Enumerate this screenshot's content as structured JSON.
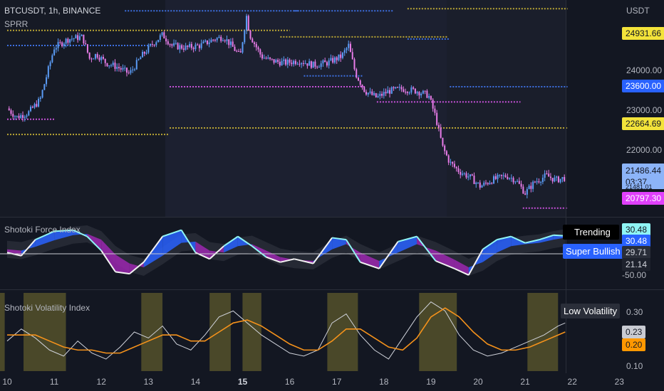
{
  "header": {
    "symbol": "BTCUSDT, 1h, BINANCE",
    "indicator": "SPRR",
    "currency": "USDT"
  },
  "colors": {
    "background": "#131722",
    "up": "#5b9cf6",
    "down": "#e87ce8",
    "resistance_blue": "#3d6fe0",
    "support_magenta": "#c651d8",
    "gold": "#b9a534",
    "force_pos": "#2962ff",
    "force_neg": "#9c27b0",
    "vol_fast": "#cfd2da",
    "vol_slow": "#f5921b",
    "low_vol_band": "#5e5a2c"
  },
  "price_panel": {
    "axis_ticks": [
      "24000.00",
      "23000.00",
      "22000.00"
    ],
    "tags": {
      "r1": "24931.66",
      "r2": "23600.00",
      "r3": "22664.69",
      "last": "21486.44",
      "countdown": "03:37",
      "low": "20797.30",
      "hidden_small": "21481.01"
    }
  },
  "force_panel": {
    "title": "Shotoki Force Index",
    "trend_label": "Trending",
    "state_label": "Super Bullish",
    "tags": [
      "30.48",
      "30.48",
      "29.71",
      "21.14",
      "-50.00"
    ]
  },
  "volatility_panel": {
    "title": "Shotoki Volatility Index",
    "state_label": "Low Volatility",
    "axis_ticks": [
      "0.30",
      "0.10"
    ],
    "tags": [
      "0.23",
      "0.20"
    ]
  },
  "x_axis": {
    "labels": [
      "10",
      "11",
      "12",
      "13",
      "14",
      "15",
      "16",
      "17",
      "18",
      "19",
      "20",
      "21",
      "22",
      "23"
    ]
  },
  "chart_data": [
    {
      "type": "candlestick",
      "title": "BTCUSDT, 1h, BINANCE",
      "x_labels": [
        "10",
        "11",
        "12",
        "13",
        "14",
        "15",
        "16",
        "17",
        "18",
        "19",
        "20",
        "21",
        "22",
        "23"
      ],
      "ylim": [
        20600,
        25600
      ],
      "price_path": [
        [
          0,
          23100
        ],
        [
          0.2,
          22900
        ],
        [
          0.45,
          23000
        ],
        [
          0.7,
          23300
        ],
        [
          0.85,
          23900
        ],
        [
          1.0,
          24500
        ],
        [
          1.3,
          24700
        ],
        [
          1.6,
          24750
        ],
        [
          1.75,
          24250
        ],
        [
          1.9,
          24350
        ],
        [
          2.1,
          24150
        ],
        [
          2.35,
          24050
        ],
        [
          2.6,
          23900
        ],
        [
          2.85,
          24300
        ],
        [
          3.1,
          24600
        ],
        [
          3.3,
          24800
        ],
        [
          3.5,
          24550
        ],
        [
          3.8,
          24500
        ],
        [
          4.1,
          24550
        ],
        [
          4.4,
          24700
        ],
        [
          4.6,
          24750
        ],
        [
          4.8,
          24500
        ],
        [
          4.95,
          24300
        ],
        [
          5.08,
          25250
        ],
        [
          5.15,
          24800
        ],
        [
          5.4,
          24300
        ],
        [
          5.6,
          24200
        ],
        [
          5.9,
          24150
        ],
        [
          6.2,
          24200
        ],
        [
          6.5,
          24100
        ],
        [
          6.8,
          24150
        ],
        [
          7.1,
          24300
        ],
        [
          7.25,
          24550
        ],
        [
          7.4,
          23900
        ],
        [
          7.6,
          23500
        ],
        [
          7.85,
          23350
        ],
        [
          8.1,
          23500
        ],
        [
          8.4,
          23550
        ],
        [
          8.7,
          23500
        ],
        [
          8.95,
          23400
        ],
        [
          9.1,
          22900
        ],
        [
          9.25,
          22200
        ],
        [
          9.4,
          21850
        ],
        [
          9.6,
          21650
        ],
        [
          9.85,
          21500
        ],
        [
          10.05,
          21300
        ],
        [
          10.3,
          21450
        ],
        [
          10.6,
          21550
        ],
        [
          10.8,
          21450
        ],
        [
          11.0,
          21150
        ],
        [
          11.2,
          21400
        ],
        [
          11.45,
          21550
        ],
        [
          11.65,
          21450
        ],
        [
          11.85,
          21500
        ]
      ],
      "levels": [
        {
          "price": 25350,
          "x0": 2.5,
          "x1": 6.2,
          "color": "blue"
        },
        {
          "price": 24900,
          "x0": 0.0,
          "x1": 6.0,
          "color": "gold"
        },
        {
          "price": 24750,
          "x0": 5.8,
          "x1": 9.35,
          "color": "gold"
        },
        {
          "price": 25350,
          "x0": 6.1,
          "x1": 8.2,
          "color": "blue"
        },
        {
          "price": 25400,
          "x0": 8.5,
          "x1": 11.9,
          "color": "gold"
        },
        {
          "price": 24700,
          "x0": 8.5,
          "x1": 9.4,
          "color": "blue"
        },
        {
          "price": 24550,
          "x0": 0.0,
          "x1": 3.0,
          "color": "blue"
        },
        {
          "price": 23600,
          "x0": 3.45,
          "x1": 7.6,
          "color": "magenta"
        },
        {
          "price": 23850,
          "x0": 6.3,
          "x1": 7.55,
          "color": "blue"
        },
        {
          "price": 23600,
          "x0": 9.4,
          "x1": 11.9,
          "color": "blue"
        },
        {
          "price": 23250,
          "x0": 7.85,
          "x1": 10.9,
          "color": "magenta"
        },
        {
          "price": 22650,
          "x0": 3.45,
          "x1": 11.9,
          "color": "gold"
        },
        {
          "price": 22850,
          "x0": 0.0,
          "x1": 1.0,
          "color": "magenta"
        },
        {
          "price": 22500,
          "x0": 0.0,
          "x1": 3.45,
          "color": "gold"
        },
        {
          "price": 20800,
          "x0": 10.95,
          "x1": 11.9,
          "color": "magenta"
        }
      ]
    },
    {
      "type": "area",
      "title": "Shotoki Force Index",
      "ylim": [
        -60,
        45
      ],
      "x": [
        0,
        0.3,
        0.6,
        1.0,
        1.4,
        1.7,
        2.0,
        2.3,
        2.6,
        2.9,
        3.3,
        3.7,
        4.0,
        4.3,
        4.6,
        4.9,
        5.2,
        5.5,
        5.8,
        6.1,
        6.5,
        6.9,
        7.2,
        7.5,
        7.9,
        8.3,
        8.7,
        9.1,
        9.5,
        9.8,
        10.1,
        10.4,
        10.7,
        11.0,
        11.3,
        11.6,
        11.85
      ],
      "fast": [
        -5,
        -10,
        15,
        28,
        30,
        20,
        -2,
        -35,
        -38,
        -20,
        20,
        30,
        -5,
        -15,
        5,
        20,
        5,
        -12,
        -20,
        -15,
        -22,
        18,
        15,
        -20,
        -30,
        12,
        20,
        -18,
        -30,
        -40,
        0,
        15,
        20,
        10,
        15,
        22,
        21
      ],
      "slow": [
        0,
        -2,
        4,
        14,
        22,
        24,
        15,
        -8,
        -22,
        -28,
        -10,
        10,
        12,
        -2,
        -5,
        5,
        8,
        -2,
        -12,
        -16,
        -18,
        0,
        8,
        -5,
        -18,
        -5,
        8,
        -2,
        -16,
        -28,
        -20,
        -5,
        5,
        8,
        10,
        15,
        18
      ]
    },
    {
      "type": "line",
      "title": "Shotoki Volatility Index",
      "ylim": [
        0.08,
        0.34
      ],
      "series": [
        {
          "name": "",
          "x": [
            0,
            0.3,
            0.6,
            0.9,
            1.2,
            1.5,
            1.8,
            2.1,
            2.4,
            2.7,
            3.0,
            3.3,
            3.6,
            3.9,
            4.2,
            4.5,
            4.8,
            5.1,
            5.4,
            5.7,
            6.0,
            6.3,
            6.6,
            6.9,
            7.2,
            7.5,
            7.8,
            8.1,
            8.4,
            8.7,
            9.0,
            9.3,
            9.6,
            9.9,
            10.2,
            10.5,
            10.8,
            11.1,
            11.4,
            11.7,
            11.85
          ],
          "y": [
            0.18,
            0.22,
            0.19,
            0.15,
            0.13,
            0.18,
            0.14,
            0.12,
            0.16,
            0.21,
            0.19,
            0.23,
            0.17,
            0.15,
            0.2,
            0.26,
            0.28,
            0.24,
            0.2,
            0.17,
            0.14,
            0.13,
            0.15,
            0.24,
            0.27,
            0.2,
            0.15,
            0.12,
            0.19,
            0.26,
            0.31,
            0.28,
            0.2,
            0.15,
            0.13,
            0.14,
            0.16,
            0.18,
            0.2,
            0.23,
            0.24
          ]
        },
        {
          "name": "",
          "x": [
            0,
            0.3,
            0.6,
            0.9,
            1.2,
            1.5,
            1.8,
            2.1,
            2.4,
            2.7,
            3.0,
            3.3,
            3.6,
            3.9,
            4.2,
            4.5,
            4.8,
            5.1,
            5.4,
            5.7,
            6.0,
            6.3,
            6.6,
            6.9,
            7.2,
            7.5,
            7.8,
            8.1,
            8.4,
            8.7,
            9.0,
            9.3,
            9.6,
            9.9,
            10.2,
            10.5,
            10.8,
            11.1,
            11.4,
            11.7,
            11.85
          ],
          "y": [
            0.2,
            0.2,
            0.2,
            0.18,
            0.16,
            0.15,
            0.15,
            0.14,
            0.14,
            0.16,
            0.18,
            0.2,
            0.2,
            0.18,
            0.18,
            0.21,
            0.24,
            0.25,
            0.23,
            0.2,
            0.17,
            0.15,
            0.15,
            0.18,
            0.22,
            0.22,
            0.19,
            0.16,
            0.15,
            0.19,
            0.26,
            0.29,
            0.26,
            0.21,
            0.17,
            0.15,
            0.15,
            0.16,
            0.18,
            0.2,
            0.21
          ]
        }
      ],
      "bands": [
        [
          0.0,
          0.1
        ],
        [
          0.5,
          1.4
        ],
        [
          3.0,
          3.45
        ],
        [
          4.45,
          4.9
        ],
        [
          5.15,
          5.55
        ],
        [
          6.95,
          7.6
        ],
        [
          8.9,
          9.7
        ],
        [
          11.2,
          11.85
        ]
      ]
    }
  ]
}
